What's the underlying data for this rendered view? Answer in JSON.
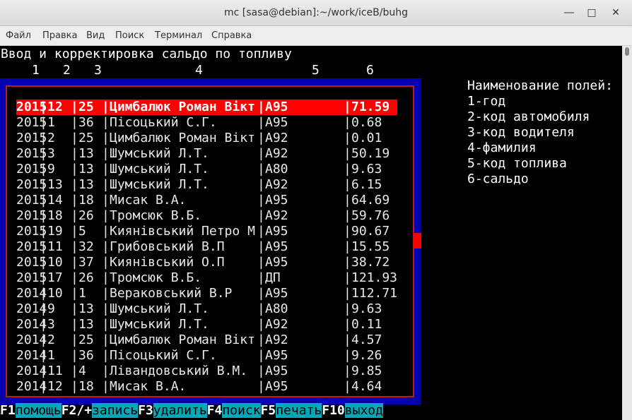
{
  "window": {
    "title": "mc [sasa@debian]:~/work/iceB/buhg",
    "minimize_icon": "minimize-icon",
    "maximize_icon": "maximize-icon",
    "close_icon": "close-icon"
  },
  "menu": [
    "Файл",
    "Правка",
    "Вид",
    "Поиск",
    "Терминал",
    "Справка"
  ],
  "screen": {
    "heading": "Ввод и корректировка сальдо по топливу",
    "column_numbers": [
      "1",
      "2",
      "3",
      "4",
      "5",
      "6"
    ],
    "rows": [
      [
        "2015",
        "12",
        "25",
        "Цимбалюк Роман Вікт",
        "А95",
        "71.59"
      ],
      [
        "2015",
        "1",
        "36",
        "Пісоцький С.Г.",
        "А95",
        "0.68"
      ],
      [
        "2015",
        "2",
        "25",
        "Цимбалюк Роман Вікт",
        "А92",
        "0.01"
      ],
      [
        "2015",
        "3",
        "13",
        "Шумський Л.Т.",
        "А92",
        "50.19"
      ],
      [
        "2015",
        "9",
        "13",
        "Шумський Л.Т.",
        "А80",
        "9.63"
      ],
      [
        "2015",
        "13",
        "13",
        "Шумський Л.Т.",
        "А92",
        "6.15"
      ],
      [
        "2015",
        "14",
        "18",
        "Мисак В.А.",
        "А95",
        "64.69"
      ],
      [
        "2015",
        "18",
        "26",
        "Тромсюк В.Б.",
        "А92",
        "59.76"
      ],
      [
        "2015",
        "19",
        "5",
        "Киянівський Петро М",
        "А95",
        "90.67"
      ],
      [
        "2015",
        "11",
        "32",
        "Грибовський В.П",
        "А95",
        "15.55"
      ],
      [
        "2015",
        "10",
        "37",
        "Киянівський О.П",
        "А95",
        "38.72"
      ],
      [
        "2015",
        "17",
        "26",
        "Тромсюк В.Б.",
        "ДП",
        "121.93"
      ],
      [
        "2014",
        "10",
        "1",
        "Вераковський В.Р",
        "А95",
        "112.71"
      ],
      [
        "2014",
        "9",
        "13",
        "Шумський Л.Т.",
        "А80",
        "9.63"
      ],
      [
        "2014",
        "3",
        "13",
        "Шумський Л.Т.",
        "А92",
        "0.11"
      ],
      [
        "2014",
        "2",
        "25",
        "Цимбалюк Роман Вікт",
        "А92",
        "4.57"
      ],
      [
        "2014",
        "1",
        "36",
        "Пісоцький С.Г.",
        "А95",
        "9.26"
      ],
      [
        "2014",
        "11",
        "4",
        "Лівандовський В.М.",
        "А95",
        "9.85"
      ],
      [
        "2014",
        "12",
        "18",
        "Мисак В.А.",
        "А95",
        "4.64"
      ]
    ],
    "selected_row": 0,
    "legend": [
      "Наименование полей:",
      "1-год",
      "2-код автомобиля",
      "3-код водителя",
      "4-фамилия",
      "5-код топлива",
      "6-сальдо"
    ],
    "function_keys": [
      {
        "key": "F1",
        "label": "помощь"
      },
      {
        "key": "F2/+",
        "label": "запись"
      },
      {
        "key": "F3",
        "label": "удалить"
      },
      {
        "key": "F4",
        "label": "поиск"
      },
      {
        "key": "F5",
        "label": "печать"
      },
      {
        "key": "F10",
        "label": "выход"
      }
    ]
  }
}
